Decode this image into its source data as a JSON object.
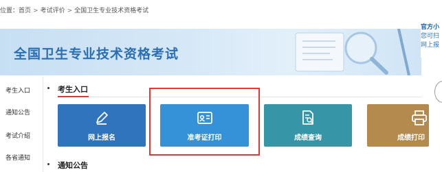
{
  "breadcrumb": {
    "prefix": "位置：",
    "items": [
      "首页",
      "考试评价",
      "全国卫生专业技术资格考试"
    ],
    "separator": ">"
  },
  "banner": {
    "title": "全国卫生专业技术资格考试"
  },
  "right_notice": {
    "line1": "官方小",
    "line2": "您可扫",
    "line3": "网上报"
  },
  "sidebar": {
    "items": [
      "考生入口",
      "通知公告",
      "考试介绍",
      "各省通知"
    ]
  },
  "section": {
    "title": "考生入口"
  },
  "tiles": [
    {
      "label": "网上报名",
      "icon": "pencil-icon",
      "color": "#2f74bd"
    },
    {
      "label": "准考证打印",
      "icon": "id-card-icon",
      "color": "#3591d8"
    },
    {
      "label": "成绩查询",
      "icon": "document-search-icon",
      "color": "#3696a8"
    },
    {
      "label": "成绩打印",
      "icon": "printer-icon",
      "color": "#b48a4f"
    }
  ],
  "notice_section": {
    "title": "通知公告"
  },
  "colors": {
    "highlight": "#e33333",
    "section_underline": "#d23b3b",
    "banner_title": "#2a6fb6"
  }
}
